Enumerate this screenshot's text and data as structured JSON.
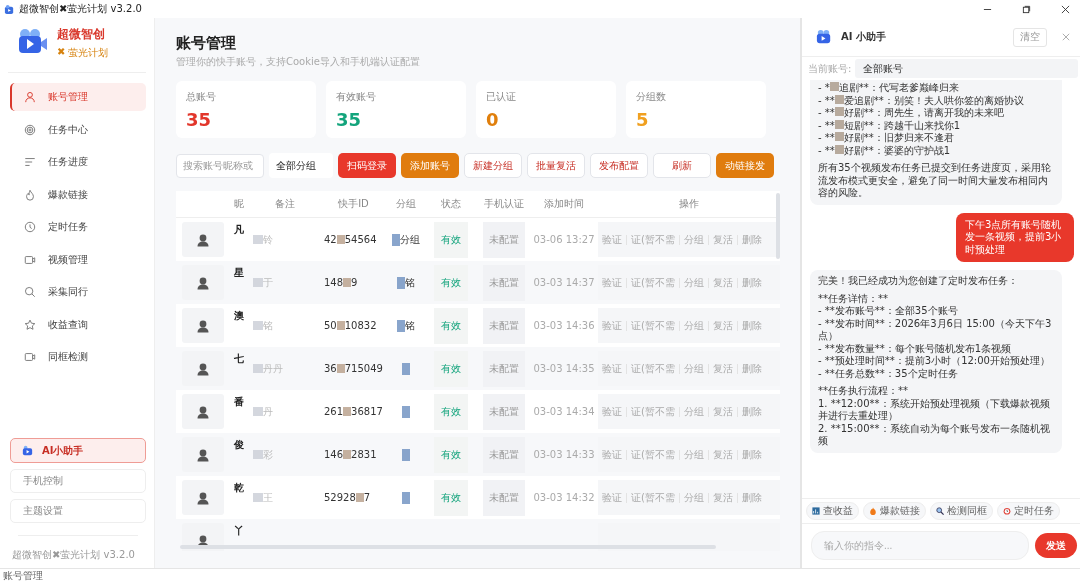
{
  "window": {
    "title": "超微智创✖萤光计划 v3.2.0"
  },
  "sidebar": {
    "brand": "超微智创",
    "sub_brand_mark": "✖",
    "sub_brand": "萤光计划",
    "items": [
      {
        "label": "账号管理",
        "selected": true
      },
      {
        "label": "任务中心",
        "selected": false
      },
      {
        "label": "任务进度",
        "selected": false
      },
      {
        "label": "爆款链接",
        "selected": false
      },
      {
        "label": "定时任务",
        "selected": false
      },
      {
        "label": "视频管理",
        "selected": false
      },
      {
        "label": "采集同行",
        "selected": false
      },
      {
        "label": "收益查询",
        "selected": false
      },
      {
        "label": "同框检测",
        "selected": false
      }
    ],
    "assistant_button": "AI小助手",
    "bottom_buttons": [
      "手机控制",
      "主题设置"
    ],
    "footer": "超微智创✖萤光计划 v3.2.0"
  },
  "main": {
    "title": "账号管理",
    "subtitle": "管理你的快手账号，支持Cookie导入和手机端认证配置",
    "stats": [
      {
        "label": "总账号",
        "value": "35",
        "color": "#e2362b"
      },
      {
        "label": "有效账号",
        "value": "35",
        "color": "#13a47c"
      },
      {
        "label": "已认证",
        "value": "0",
        "color": "#e07f0c"
      },
      {
        "label": "分组数",
        "value": "5",
        "color": "#f0a020"
      }
    ],
    "search": {
      "placeholder": "搜索账号昵称或"
    },
    "group_select": "全部分组",
    "buttons": [
      {
        "label": "扫码登录",
        "kind": "red"
      },
      {
        "label": "添加账号",
        "kind": "orange"
      },
      {
        "label": "新建分组",
        "kind": "outline"
      },
      {
        "label": "批量复活",
        "kind": "outline"
      },
      {
        "label": "发布配置",
        "kind": "outline"
      },
      {
        "label": "刷新",
        "kind": "outline"
      },
      {
        "label": "动链接发",
        "kind": "orange"
      }
    ],
    "table": {
      "columns": [
        "昵",
        "备注",
        "快手ID",
        "分组",
        "状态",
        "手机认证",
        "添加时间",
        "操作"
      ],
      "rows": [
        {
          "name": "凡",
          "remark": "铃",
          "id_start": "42",
          "id_end": "54564",
          "group": "分组",
          "status": "有效",
          "auth": "未配置",
          "time": "03-06 13:27",
          "actions": [
            "验证",
            "证(暂不需",
            "分组",
            "复活",
            "删除"
          ]
        },
        {
          "name": "星",
          "remark": "于",
          "id_start": "148",
          "id_end": "9",
          "group": "铭",
          "status": "有效",
          "auth": "未配置",
          "time": "03-03 14:37",
          "actions": [
            "验证",
            "证(暂不需",
            "分组",
            "复活",
            "删除"
          ]
        },
        {
          "name": "澳",
          "remark": "铭",
          "id_start": "50",
          "id_end": "10832",
          "group": "铭",
          "status": "有效",
          "auth": "未配置",
          "time": "03-03 14:36",
          "actions": [
            "验证",
            "证(暂不需",
            "分组",
            "复活",
            "删除"
          ]
        },
        {
          "name": "七",
          "remark": "丹丹",
          "id_start": "36",
          "id_end": "715049",
          "status": "有效",
          "auth": "未配置",
          "time": "03-03 14:35",
          "actions": [
            "验证",
            "证(暂不需",
            "分组",
            "复活",
            "删除"
          ]
        },
        {
          "name": "番",
          "remark": "丹",
          "id_start": "261",
          "id_end": "36817",
          "status": "有效",
          "auth": "未配置",
          "time": "03-03 14:34",
          "actions": [
            "验证",
            "证(暂不需",
            "分组",
            "复活",
            "删除"
          ]
        },
        {
          "name": "俊",
          "remark": "彩",
          "id_start": "146",
          "id_end": "2831",
          "status": "有效",
          "auth": "未配置",
          "time": "03-03 14:33",
          "actions": [
            "验证",
            "证(暂不需",
            "分组",
            "复活",
            "删除"
          ]
        },
        {
          "name": "乾",
          "remark": "王",
          "id_start": "52928",
          "id_end": "7",
          "status": "有效",
          "auth": "未配置",
          "time": "03-03 14:32",
          "actions": [
            "验证",
            "证(暂不需",
            "分组",
            "复活",
            "删除"
          ]
        },
        {
          "name": "丫"
        }
      ]
    }
  },
  "assistant": {
    "title": "AI 小助手",
    "clear_button": "清空",
    "account_label": "当前账号:",
    "account_select": "全部账号",
    "messages": [
      {
        "kind": "assistant",
        "list": [
          {
            "pre": "- *",
            "post": "追剧**：代写老爹巅峰归来"
          },
          {
            "pre": "- **",
            "post": "爱追剧**：别笑！夫人哄你签的离婚协议"
          },
          {
            "pre": "- **",
            "post": "好剧**：周先生，请离开我的未来吧"
          },
          {
            "pre": "- **",
            "post": "短剧**：跨越千山来找你1"
          },
          {
            "pre": "- **",
            "post": "好剧**：旧梦归来不逢君"
          },
          {
            "pre": "- **",
            "post": "好剧**：婆婆的守护战1"
          }
        ],
        "paragraphs": [
          "所有35个视频发布任务已提交到任务进度页，采用轮流发布模式更安全，避免了同一时间大量发布相同内容的风险。"
        ]
      },
      {
        "kind": "user",
        "paragraphs": [
          "下午3点所有账号随机发一条视频，提前3小时预处理"
        ]
      },
      {
        "kind": "assistant",
        "paragraphs": [
          "完美！我已经成功为您创建了定时发布任务：",
          "**任务详情：**\n- **发布账号**：全部35个账号\n- **发布时间**：2026年3月6日 15:00（今天下午3点）\n- **发布数量**：每个账号随机发布1条视频\n- **预处理时间**：提前3小时（12:00开始预处理）\n- **任务总数**：35个定时任务",
          "**任务执行流程：**\n1. **12:00**：系统开始预处理视频（下载爆款视频并进行去重处理）\n2. **15:00**：系统自动为每个账号发布一条随机视频"
        ]
      }
    ],
    "chips": [
      "查收益",
      "爆款链接",
      "检测同框",
      "定时任务"
    ],
    "input": {
      "placeholder": "输入你的指令..."
    },
    "send_button": "发送"
  },
  "status_bar": "账号管理"
}
